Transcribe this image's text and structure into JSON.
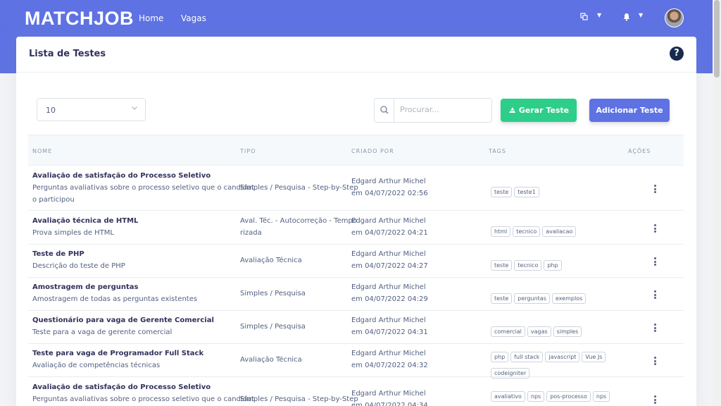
{
  "app": {
    "brand": "MATCHJOB",
    "nav": [
      "Home",
      "Vagas"
    ]
  },
  "page": {
    "title": "Lista de Testes",
    "help_icon_char": "?"
  },
  "controls": {
    "page_size": "10",
    "search_placeholder": "Procurar...",
    "generate_label": "Gerar Teste",
    "add_label": "Adicionar Teste"
  },
  "table": {
    "headers": [
      "NOME",
      "TIPO",
      "CRIADO POR",
      "TAGS",
      "AÇÕES"
    ],
    "rows": [
      {
        "name": "Avaliação de satisfação do Processo Seletivo",
        "desc_line1": "Perguntas avaliativas sobre o processo seletivo que o candidat",
        "desc_line2": "o participou",
        "type_line1": "Simples / Pesquisa - Step-by-Step",
        "type_line2": "",
        "created_by": "Edgard Arthur Michel",
        "created_at": "em 04/07/2022 02:56",
        "tags": [
          "teste",
          "teste1"
        ]
      },
      {
        "name": "Avaliação técnica de HTML",
        "desc_line1": "Prova simples de HTML",
        "desc_line2": "",
        "type_line1": "Aval. Téc. - Autocorreção - Tempo",
        "type_line2": "rizada",
        "created_by": "Edgard Arthur Michel",
        "created_at": "em 04/07/2022 04:21",
        "tags": [
          "html",
          "tecnico",
          "avaliacao"
        ]
      },
      {
        "name": "Teste de PHP",
        "desc_line1": "Descrição do teste de PHP",
        "desc_line2": "",
        "type_line1": "Avaliação Técnica",
        "type_line2": "",
        "created_by": "Edgard Arthur Michel",
        "created_at": "em 04/07/2022 04:27",
        "tags": [
          "teste",
          "tecnico",
          "php"
        ]
      },
      {
        "name": "Amostragem de perguntas",
        "desc_line1": "Amostragem de todas as perguntas existentes",
        "desc_line2": "",
        "type_line1": "Simples / Pesquisa",
        "type_line2": "",
        "created_by": "Edgard Arthur Michel",
        "created_at": "em 04/07/2022 04:29",
        "tags": [
          "teste",
          "perguntas",
          "exemplos"
        ]
      },
      {
        "name": "Questionário para vaga de Gerente Comercial",
        "desc_line1": "Teste para a vaga de gerente comercial",
        "desc_line2": "",
        "type_line1": "Simples / Pesquisa",
        "type_line2": "",
        "created_by": "Edgard Arthur Michel",
        "created_at": "em 04/07/2022 04:31",
        "tags": [
          "comercial",
          "vagas",
          "simples"
        ]
      },
      {
        "name": "Teste para vaga de Programador Full Stack",
        "desc_line1": "Avaliação de competências técnicas",
        "desc_line2": "",
        "type_line1": "Avaliação Técnica",
        "type_line2": "",
        "created_by": "Edgard Arthur Michel",
        "created_at": "em 04/07/2022 04:32",
        "tags": [
          "php",
          "full stack",
          "javascript",
          "Vue Js",
          "codeigniter"
        ]
      },
      {
        "name": "Avaliação de satisfação do Processo Seletivo",
        "desc_line1": "Perguntas avaliativas sobre o processo seletivo que o candidat",
        "desc_line2": "",
        "type_line1": "Simples / Pesquisa - Step-by-Step",
        "type_line2": "",
        "created_by": "Edgard Arthur Michel",
        "created_at": "em 04/07/2022 04:34",
        "tags": [
          "avaliativo",
          "nps",
          "pos-processo",
          "nps"
        ]
      }
    ]
  },
  "colors": {
    "primary": "#5e72e4",
    "success": "#2dce89",
    "heading": "#32325d",
    "text": "#525f7f"
  }
}
